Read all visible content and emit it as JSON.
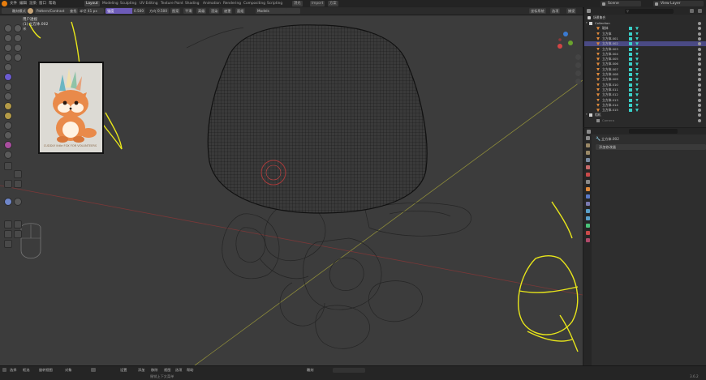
{
  "menu": [
    "文件",
    "编辑",
    "渲染",
    "窗口",
    "帮助"
  ],
  "workspaces": [
    "Layout",
    "Modeling",
    "Sculpting",
    "UV Editing",
    "Texture Paint",
    "Shading",
    "Animation",
    "Rendering",
    "Compositing",
    "Scripting"
  ],
  "active_workspace": "Layout",
  "top_right": {
    "tabs": [
      "测光",
      "Import",
      "方案"
    ],
    "scene_label": "Scene",
    "view_layer_label": "View Layer"
  },
  "toolbar": {
    "mode": "雕刻模式",
    "brush_name": "Pattern/Contrast",
    "brush_tag": "查找",
    "radius_label": "半径",
    "radius_value": "41 px",
    "strength_label": "强度",
    "strength_value": "0.500",
    "direction_label": "方向",
    "direction_value": "0.500",
    "items": [
      "图案",
      "平滑",
      "高级",
      "渲染",
      "遮罩",
      "面组"
    ],
    "viewport_btn": "Models",
    "right_items": [
      "坐标系统",
      "选项",
      "捕捉"
    ]
  },
  "viewport_header": {
    "view_label": "用户透视",
    "object_label": "(1) 立方体.002",
    "units_label": "米"
  },
  "reference": {
    "caption": "CUDDLY little FOX FOR VOLUNTEERS"
  },
  "outliner": {
    "title": "场景集合",
    "search_placeholder": "",
    "rows": [
      {
        "name": "Collection",
        "indent": 0,
        "type": "collection"
      },
      {
        "name": "磁体",
        "indent": 1,
        "type": "mesh"
      },
      {
        "name": "立方体",
        "indent": 1,
        "type": "mesh"
      },
      {
        "name": "立方体.001",
        "indent": 1,
        "type": "mesh"
      },
      {
        "name": "立方体.002",
        "indent": 1,
        "type": "mesh",
        "selected": true
      },
      {
        "name": "立方体.003",
        "indent": 1,
        "type": "mesh"
      },
      {
        "name": "立方体.004",
        "indent": 1,
        "type": "mesh"
      },
      {
        "name": "立方体.005",
        "indent": 1,
        "type": "mesh"
      },
      {
        "name": "立方体.006",
        "indent": 1,
        "type": "mesh"
      },
      {
        "name": "立方体.007",
        "indent": 1,
        "type": "mesh"
      },
      {
        "name": "立方体.008",
        "indent": 1,
        "type": "mesh"
      },
      {
        "name": "立方体.009",
        "indent": 1,
        "type": "mesh"
      },
      {
        "name": "立方体.010",
        "indent": 1,
        "type": "mesh"
      },
      {
        "name": "立方体.011",
        "indent": 1,
        "type": "mesh"
      },
      {
        "name": "立方体.012",
        "indent": 1,
        "type": "mesh"
      },
      {
        "name": "立方体.013",
        "indent": 1,
        "type": "mesh"
      },
      {
        "name": "立方体.014",
        "indent": 1,
        "type": "mesh"
      },
      {
        "name": "立方体.015",
        "indent": 1,
        "type": "mesh"
      },
      {
        "name": "相机",
        "indent": 0,
        "type": "collection"
      },
      {
        "name": "Camera",
        "indent": 1,
        "type": "camera"
      }
    ]
  },
  "properties": {
    "object_name": "立方体.002",
    "section": "添加修改器"
  },
  "statusbar": {
    "left_items": [
      "选择",
      "框选",
      "旋转视图",
      "对象"
    ],
    "mid_items": [
      "设置",
      "添加",
      "移除",
      "视图",
      "选项",
      "帮助"
    ],
    "center_label": "撤销上下文菜单",
    "right_label": "雕刻",
    "version": "3.6.2"
  },
  "colors": {
    "accent_purple": "#6d5bb8",
    "selection": "#4a4a84",
    "annotation_yellow": "#e8e61a",
    "mesh_icon": "#e08a3c",
    "modifier_icon": "#3ad0c8"
  }
}
